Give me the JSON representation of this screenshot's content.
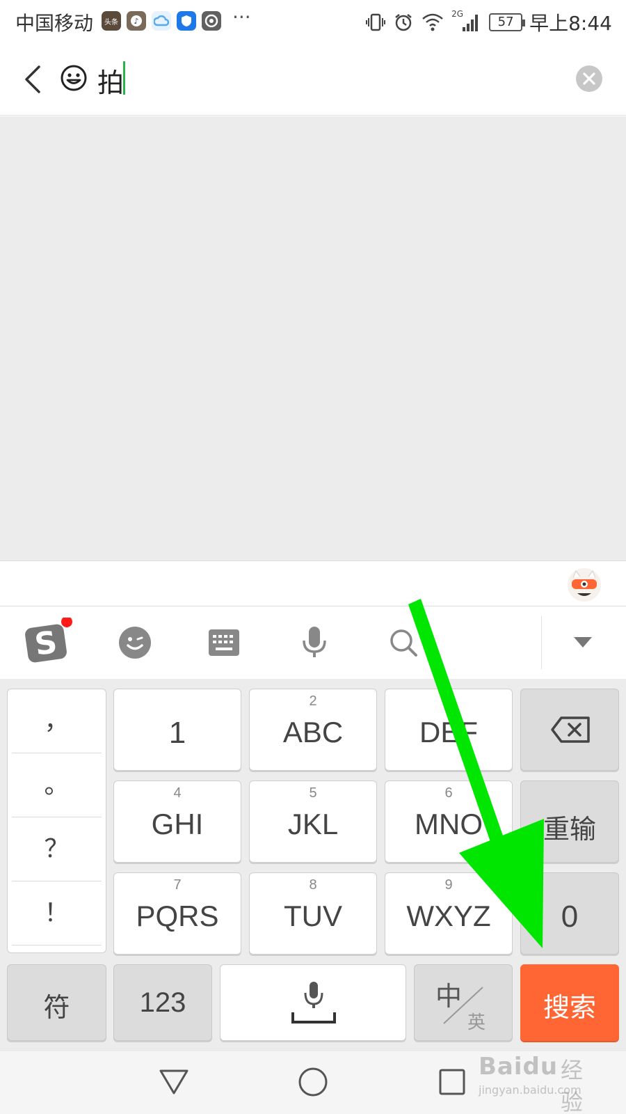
{
  "status_bar": {
    "carrier": "中国移动",
    "app_icons": [
      {
        "name": "toutiao-icon",
        "text": "头条",
        "color": "#5a4a3c"
      },
      {
        "name": "douyin-icon",
        "text": "",
        "color": "#7a6a5a"
      },
      {
        "name": "cloud-app-icon",
        "text": "",
        "color": "#58a8f0"
      },
      {
        "name": "shield-app-icon",
        "text": "",
        "color": "#1e78e6"
      },
      {
        "name": "camera-app-icon",
        "text": "",
        "color": "#606060"
      }
    ],
    "more": "···",
    "network": "2G",
    "battery": "57",
    "time": "早上8:44"
  },
  "search": {
    "query": "拍"
  },
  "toolbar": {
    "items": [
      "sogou-logo",
      "emoji-icon",
      "keyboard-icon",
      "mic-icon",
      "search-icon",
      "collapse-icon"
    ]
  },
  "keyboard": {
    "punctuation": [
      "，",
      "。",
      "？",
      "！"
    ],
    "rows": [
      [
        {
          "num": "",
          "label": "1"
        },
        {
          "num": "2",
          "label": "ABC"
        },
        {
          "num": "",
          "label": "DEF"
        }
      ],
      [
        {
          "num": "4",
          "label": "GHI"
        },
        {
          "num": "5",
          "label": "JKL"
        },
        {
          "num": "6",
          "label": "MNO"
        }
      ],
      [
        {
          "num": "7",
          "label": "PQRS"
        },
        {
          "num": "8",
          "label": "TUV"
        },
        {
          "num": "9",
          "label": "WXYZ"
        }
      ]
    ],
    "reinput": "重输",
    "zero": "0",
    "symbols": "符",
    "numbers": "123",
    "lang_zh": "中",
    "lang_en": "英",
    "search_key": "搜索",
    "accent_color": "#ff6633"
  },
  "watermark": {
    "brand": "Baidu",
    "suffix": "经验",
    "url": "jingyan.baidu.com"
  },
  "annotation": {
    "arrow_color": "#00e600"
  }
}
